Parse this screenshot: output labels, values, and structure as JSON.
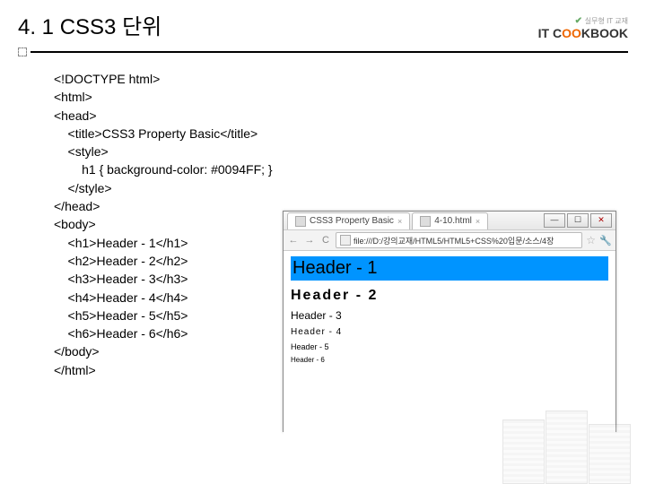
{
  "header": {
    "title": "4. 1 CSS3 단위"
  },
  "logo": {
    "tagline": "실무형 IT 교재",
    "brand_prefix": "IT C",
    "brand_highlight": "OO",
    "brand_suffix": "KBOOK"
  },
  "code": {
    "l1": "<!DOCTYPE html>",
    "l2": "<html>",
    "l3": "<head>",
    "l4": "    <title>CSS3 Property Basic</title>",
    "l5": "    <style>",
    "l6": "        h1 { background-color: #0094FF; }",
    "l7": "    </style>",
    "l8": "</head>",
    "l9": "<body>",
    "l10": "    <h1>Header - 1</h1>",
    "l11": "    <h2>Header - 2</h2>",
    "l12": "    <h3>Header - 3</h3>",
    "l13": "    <h4>Header - 4</h4>",
    "l14": "    <h5>Header - 5</h5>",
    "l15": "    <h6>Header - 6</h6>",
    "l16": "</body>",
    "l17": "</html>"
  },
  "browser": {
    "tab1": "CSS3 Property Basic",
    "tab2": "4-10.html",
    "url": "file:///D:/강의교재/HTML5/HTML5+CSS%20입문/소스/4장",
    "page": {
      "h1": "Header - 1",
      "h2": "Header - 2",
      "h3": "Header - 3",
      "h4": "Header - 4",
      "h5": "Header - 5",
      "h6": "Header - 6"
    }
  }
}
